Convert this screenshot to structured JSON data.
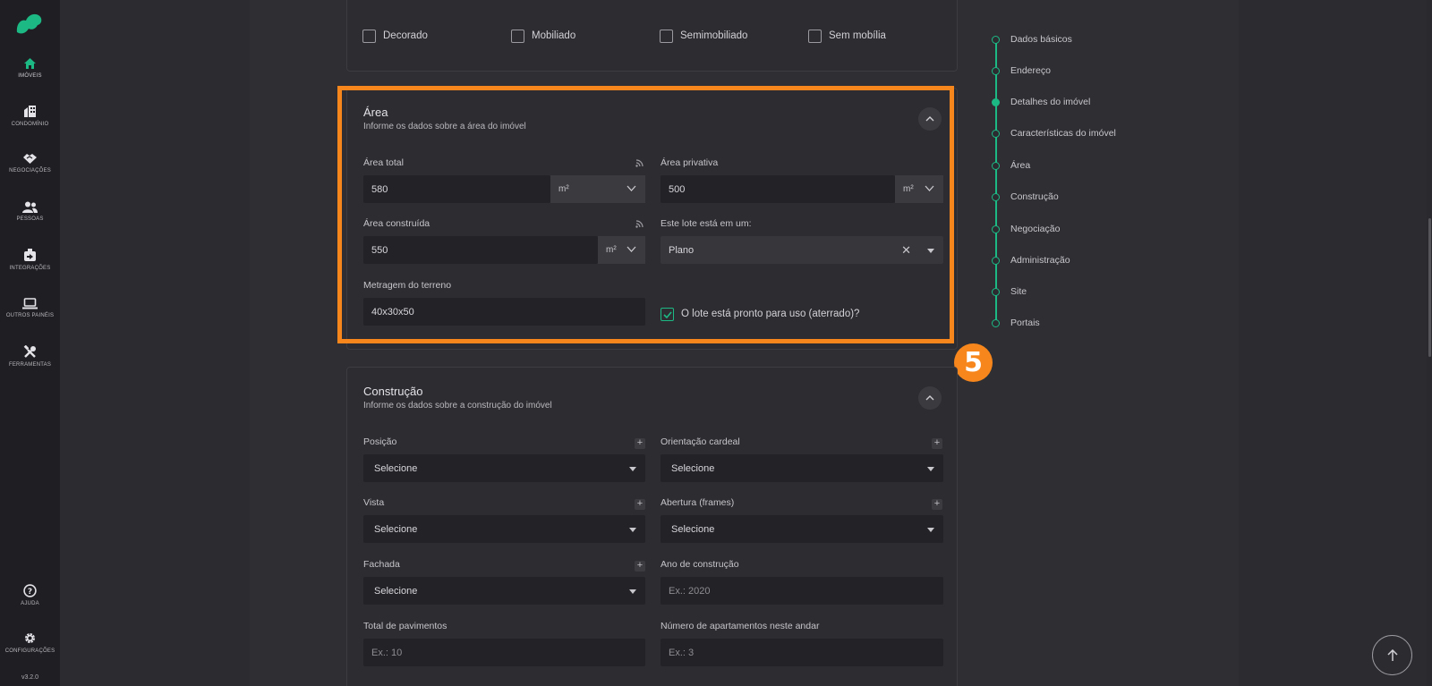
{
  "nav": {
    "version": "v3.2.0",
    "items": [
      {
        "label": "IMÓVEIS",
        "icon": "home-icon"
      },
      {
        "label": "CONDOMÍNIO",
        "icon": "building-icon"
      },
      {
        "label": "NEGOCIAÇÕES",
        "icon": "handshake-icon"
      },
      {
        "label": "PESSOAS",
        "icon": "people-icon"
      },
      {
        "label": "INTEGRAÇÕES",
        "icon": "integration-icon"
      },
      {
        "label": "OUTROS PAINÉIS",
        "icon": "laptop-icon"
      },
      {
        "label": "FERRAMENTAS",
        "icon": "tools-icon"
      },
      {
        "label": "AJUDA",
        "icon": "help-icon"
      },
      {
        "label": "CONFIGURAÇÕES",
        "icon": "gear-icon"
      }
    ]
  },
  "furnishing": {
    "options": [
      "Decorado",
      "Mobiliado",
      "Semimobiliado",
      "Sem mobília"
    ]
  },
  "area": {
    "title": "Área",
    "subtitle": "Informe os dados sobre a área do imóvel",
    "area_total_label": "Área total",
    "area_total_value": "580",
    "area_total_unit": "m²",
    "area_privativa_label": "Área privativa",
    "area_privativa_value": "500",
    "area_privativa_unit": "m²",
    "area_construida_label": "Área construída",
    "area_construida_value": "550",
    "area_construida_unit": "m²",
    "lote_label": "Este lote está em um:",
    "lote_value": "Plano",
    "metragem_label": "Metragem do terreno",
    "metragem_value": "40x30x50",
    "aterrado_label": "O lote está pronto para uso (aterrado)?"
  },
  "construcao": {
    "title": "Construção",
    "subtitle": "Informe os dados sobre a construção do imóvel",
    "posicao_label": "Posição",
    "posicao_value": "Selecione",
    "orientacao_label": "Orientação cardeal",
    "orientacao_value": "Selecione",
    "vista_label": "Vista",
    "vista_value": "Selecione",
    "abertura_label": "Abertura (frames)",
    "abertura_value": "Selecione",
    "fachada_label": "Fachada",
    "fachada_value": "Selecione",
    "ano_label": "Ano de construção",
    "ano_placeholder": "Ex.: 2020",
    "pavimentos_label": "Total de pavimentos",
    "pavimentos_placeholder": "Ex.: 10",
    "apartamentos_label": "Número de apartamentos neste andar",
    "apartamentos_placeholder": "Ex.: 3"
  },
  "step_badge": "5",
  "stepper": {
    "active_index": 2,
    "steps": [
      "Dados básicos",
      "Endereço",
      "Detalhes do imóvel",
      "Características do imóvel",
      "Área",
      "Construção",
      "Negociação",
      "Administração",
      "Site",
      "Portais"
    ]
  },
  "colors": {
    "accent": "#1db985",
    "highlight": "#f7861c"
  }
}
